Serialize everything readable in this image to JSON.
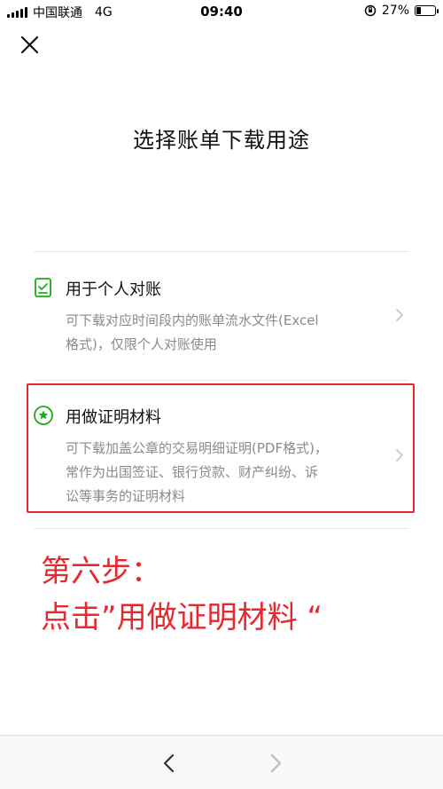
{
  "status_bar": {
    "carrier": "中国联通",
    "network": "4G",
    "time": "09:40",
    "battery": "27%",
    "battery_level": 0.27
  },
  "icons": {
    "close": "close-icon",
    "option1": "checklist-icon",
    "option2": "star-badge-icon",
    "back": "chevron-left-icon",
    "forward": "chevron-right-icon"
  },
  "colors": {
    "accent_green": "#1aad19",
    "highlight_red": "#e5292f",
    "muted_text": "#8a8a8a"
  },
  "page": {
    "title": "选择账单下载用途"
  },
  "options": [
    {
      "title": "用于个人对账",
      "desc_line1": "可下载对应时间段内的账单流水文件(Excel",
      "desc_line2": "格式)，仅限个人对账使用"
    },
    {
      "title": "用做证明材料",
      "desc_line1": "可下载加盖公章的交易明细证明(PDF格式)，",
      "desc_line2": "常作为出国签证、银行贷款、财产纠纷、诉",
      "desc_line3": "讼等事务的证明材料"
    }
  ],
  "annotation": {
    "line1": "第六步：",
    "line2": "点击”用做证明材料 “"
  }
}
